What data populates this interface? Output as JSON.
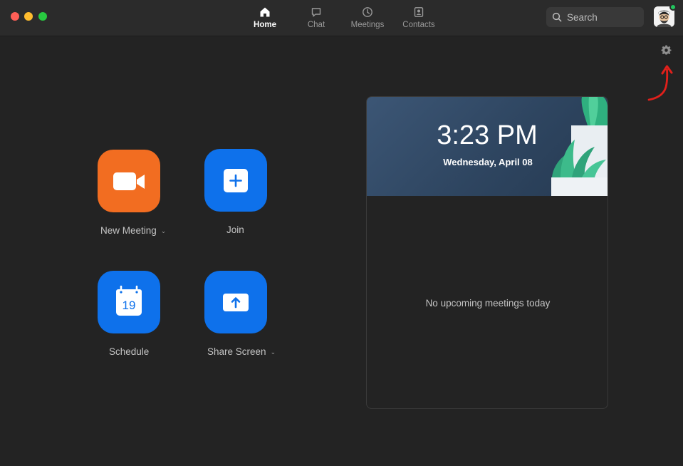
{
  "window": {
    "controls": [
      "close",
      "minimize",
      "maximize"
    ]
  },
  "nav": {
    "tabs": [
      {
        "label": "Home",
        "icon": "home-icon",
        "active": true
      },
      {
        "label": "Chat",
        "icon": "chat-bubble-icon",
        "active": false
      },
      {
        "label": "Meetings",
        "icon": "clock-icon",
        "active": false
      },
      {
        "label": "Contacts",
        "icon": "contacts-icon",
        "active": false
      }
    ]
  },
  "search": {
    "placeholder": "Search"
  },
  "profile": {
    "status_color": "#22c55e"
  },
  "actions": [
    {
      "label": "New Meeting",
      "icon": "video-camera-icon",
      "color": "#f26d21",
      "has_dropdown": true
    },
    {
      "label": "Join",
      "icon": "plus-icon",
      "color": "#0e71eb",
      "has_dropdown": false
    },
    {
      "label": "Schedule",
      "icon": "calendar-icon",
      "calendar_day": "19",
      "color": "#0e71eb",
      "has_dropdown": false
    },
    {
      "label": "Share Screen",
      "icon": "share-up-arrow-icon",
      "color": "#0e71eb",
      "has_dropdown": true
    }
  ],
  "meetings_panel": {
    "time": "3:23 PM",
    "date": "Wednesday, April 08",
    "empty_message": "No upcoming meetings today"
  },
  "colors": {
    "background": "#232323",
    "titlebar": "#2b2b2b",
    "accent_blue": "#0e71eb",
    "accent_orange": "#f26d21",
    "annotation_arrow": "#e0201b"
  }
}
